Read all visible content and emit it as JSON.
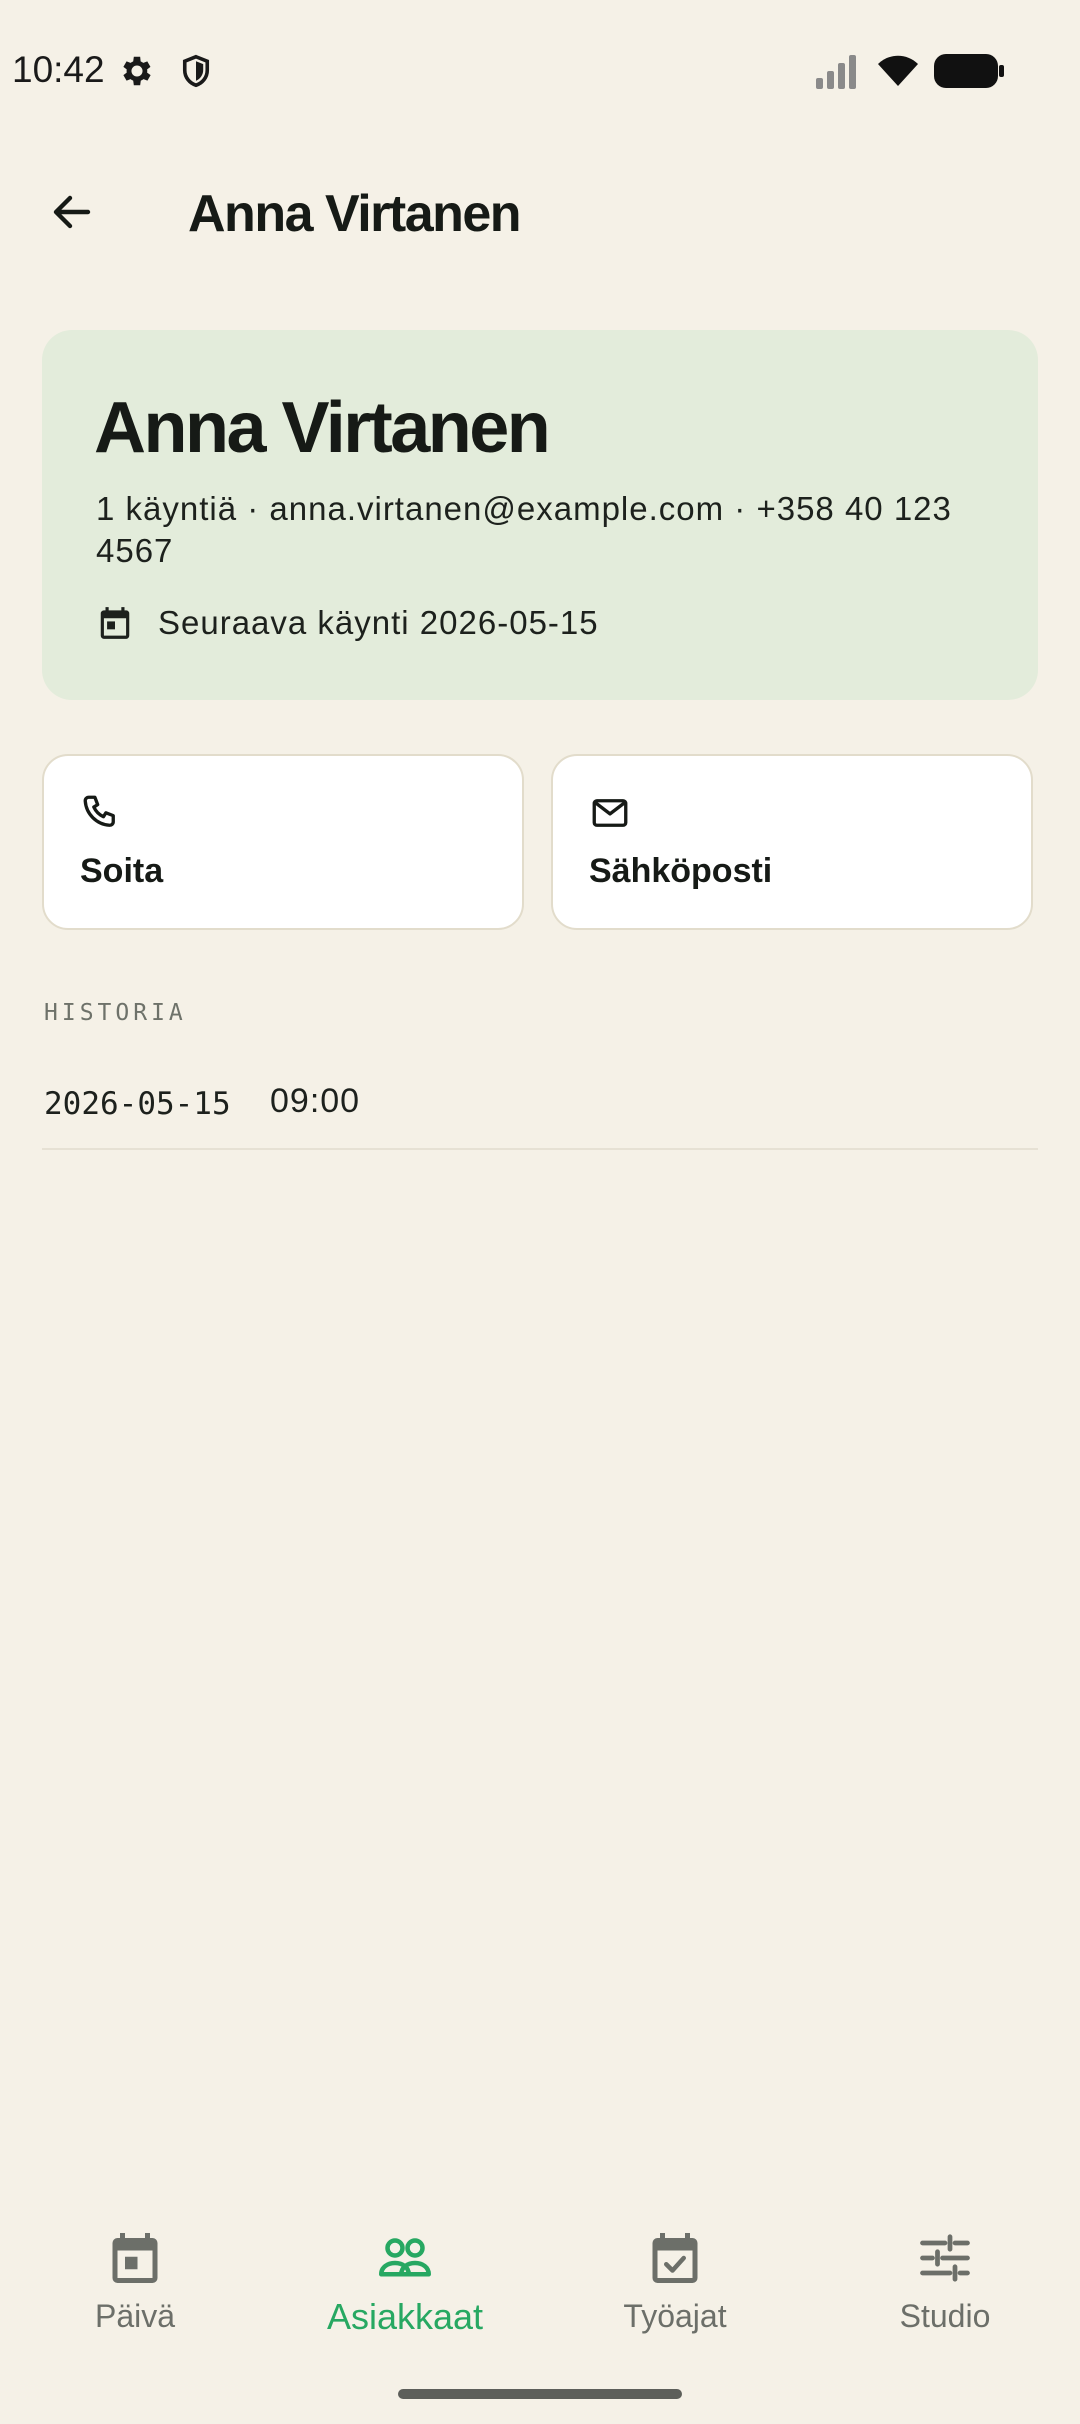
{
  "status_bar": {
    "time": "10:42",
    "icons": [
      "gear-icon",
      "shield-icon",
      "signal-icon",
      "wifi-icon",
      "battery-icon"
    ]
  },
  "app_bar": {
    "back_icon": "arrow-back-icon",
    "title": "Anna Virtanen"
  },
  "client": {
    "name": "Anna Virtanen",
    "meta": "1 käyntiä · anna.virtanen@example.com · +358 40 123 4567",
    "next_visit_icon": "calendar-icon",
    "next_visit": "Seuraava käynti 2026-05-15"
  },
  "actions": [
    {
      "label": "Soita",
      "icon": "phone-icon"
    },
    {
      "label": "Sähköposti",
      "icon": "mail-icon"
    }
  ],
  "history": {
    "label": "HISTORIA",
    "rows": [
      {
        "date": "2026-05-15",
        "time": "09:00"
      }
    ]
  },
  "bottom_nav": {
    "active": "Asiakkaat",
    "items": [
      {
        "label": "Päivä",
        "icon": "calendar-day-icon"
      },
      {
        "label": "Asiakkaat",
        "icon": "people-icon"
      },
      {
        "label": "Työajat",
        "icon": "calendar-check-icon"
      },
      {
        "label": "Studio",
        "icon": "sliders-icon"
      }
    ]
  },
  "colors": {
    "background": "#f5f1e7",
    "card": "#e3ecdb",
    "accent": "#27a862",
    "text": "#161a16"
  }
}
